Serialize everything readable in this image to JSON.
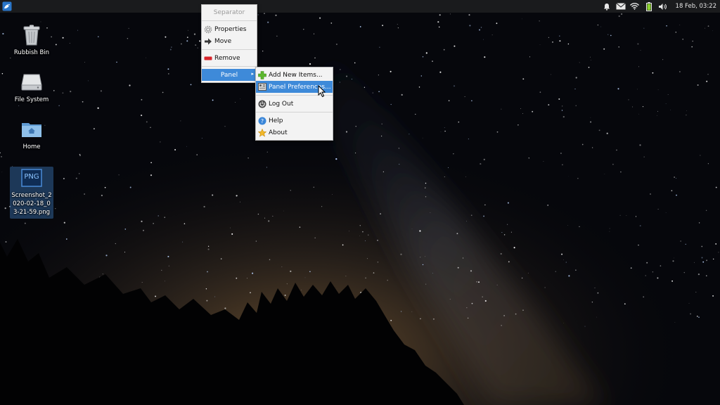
{
  "panel": {
    "clock": "18 Feb, 03:22",
    "tray_icons": [
      "bell-icon",
      "mail-icon",
      "wifi-icon",
      "battery-icon",
      "volume-icon"
    ]
  },
  "desktop": {
    "icons": [
      {
        "label": "Rubbish Bin",
        "icon": "trash-icon"
      },
      {
        "label": "File System",
        "icon": "drive-icon"
      },
      {
        "label": "Home",
        "icon": "home-folder-icon"
      },
      {
        "label": "Screenshot_2020-02-18_03-21-59.png",
        "icon": "png-file-icon",
        "badge": "PNG",
        "selected": true
      }
    ]
  },
  "context_menu": {
    "items": [
      {
        "label": "Separator",
        "disabled": true
      },
      {
        "label": "Properties",
        "icon": "gear-icon"
      },
      {
        "label": "Move",
        "icon": "arrow-right-icon"
      },
      {
        "label": "Remove",
        "icon": "remove-icon"
      },
      {
        "label": "Panel",
        "submenu": true,
        "active": true
      }
    ]
  },
  "panel_submenu": {
    "items": [
      {
        "label": "Add New Items...",
        "icon": "add-icon"
      },
      {
        "label": "Panel Preferences...",
        "icon": "preferences-icon",
        "active": true
      },
      {
        "label": "Log Out",
        "icon": "power-icon"
      },
      {
        "label": "Help",
        "icon": "help-icon"
      },
      {
        "label": "About",
        "icon": "star-icon"
      }
    ]
  },
  "colors": {
    "menu_highlight": "#3e8ad9",
    "panel_bg": "#1a1b1d",
    "menu_bg": "#f3f3f3"
  }
}
